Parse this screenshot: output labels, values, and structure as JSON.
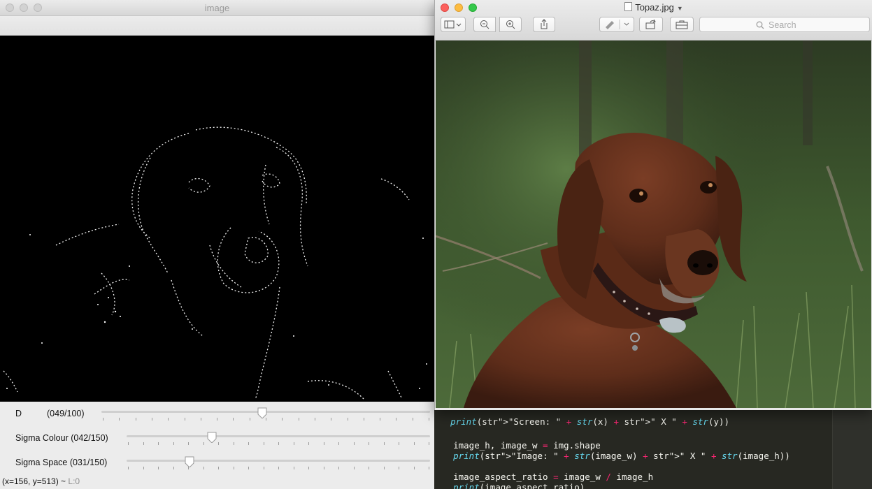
{
  "opencv_window": {
    "title": "image",
    "trackbars": [
      {
        "label": "D",
        "value_text": "(049/100)",
        "value": 49,
        "max": 100
      },
      {
        "label": "Sigma Colour (042/150)",
        "value": 42,
        "max": 150
      },
      {
        "label": "Sigma Space (031/150)",
        "value": 31,
        "max": 150
      }
    ],
    "status": {
      "coords": "(x=156, y=513) ~ ",
      "level": "L:0"
    }
  },
  "preview_window": {
    "title": "Topaz.jpg",
    "search_placeholder": "Search",
    "toolbar_icons": [
      "sidebar-icon",
      "zoom-out-icon",
      "zoom-in-icon",
      "share-icon",
      "markup-pen-icon",
      "rotate-icon",
      "toolbox-icon"
    ]
  },
  "editor": {
    "lines": [
      "print(\"Screen: \" + str(x) + \" X \" + str(y))",
      "image_h, image_w = img.shape",
      "print(\"Image: \" + str(image_w) + \" X \" + str(image_h))",
      "image_aspect_ratio = image_w / image_h",
      "print(image_aspect_ratio)"
    ]
  },
  "colors": {
    "editor_bg": "#272822",
    "close": "#fc605c",
    "minimize": "#fdbc40",
    "zoom": "#34c84a"
  }
}
